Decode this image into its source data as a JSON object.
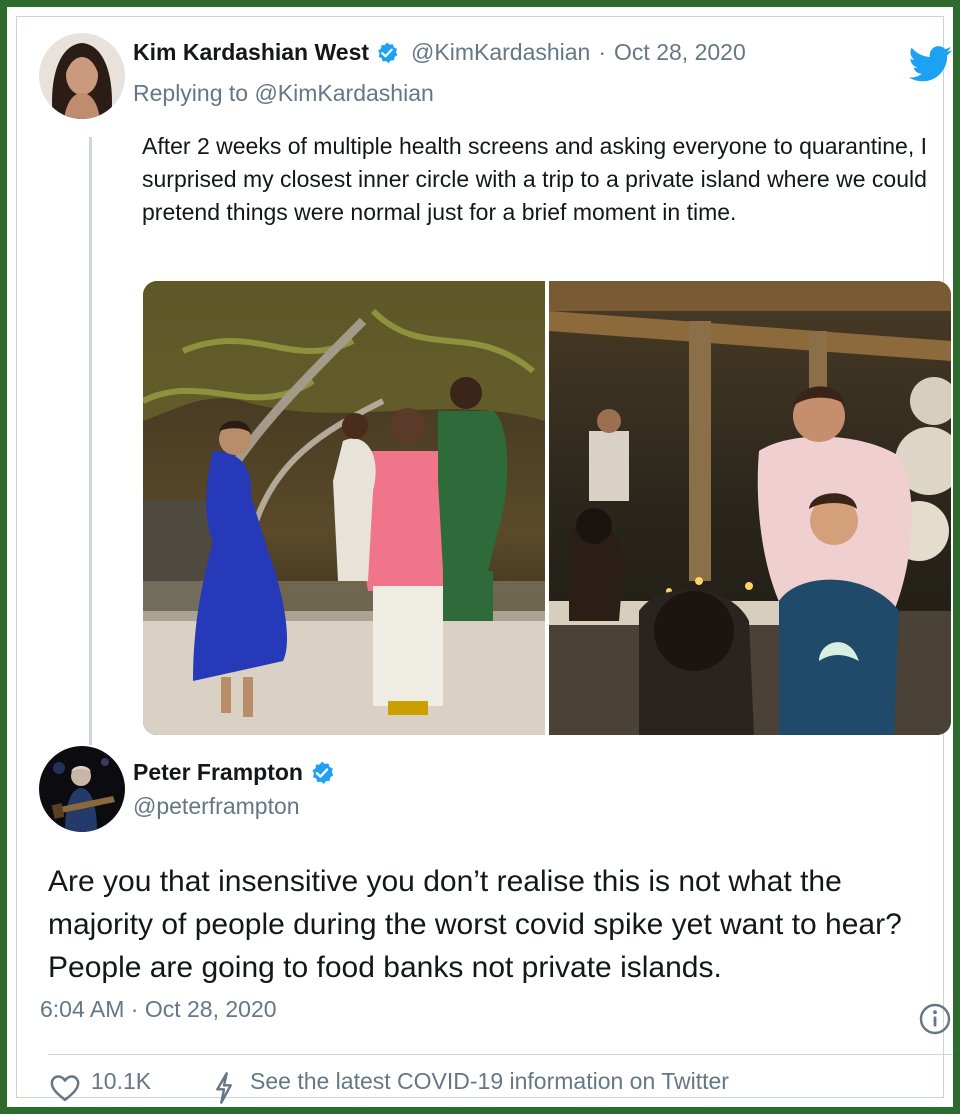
{
  "original_tweet": {
    "author_name": "Kim Kardashian West",
    "author_handle": "@KimKardashian",
    "separator": "·",
    "date": "Oct 28, 2020",
    "replying_to": "Replying to @KimKardashian",
    "text": "After 2 weeks of multiple health screens and asking everyone to quarantine, I surprised my closest inner circle with a trip to a private island where we could pretend things were normal just for a brief moment in time.",
    "verified": true
  },
  "reply_tweet": {
    "author_name": "Peter Frampton",
    "author_handle": "@peterframpton",
    "verified": true,
    "text": "Are you that insensitive you don’t realise this is not what the majority of people during the worst covid spike yet want to hear? People are going to food banks not private islands.",
    "timestamp": "6:04 AM · Oct 28, 2020"
  },
  "actions": {
    "like_count": "10.1K",
    "covid_link": "See the latest COVID-19 information on Twitter"
  },
  "icons": {
    "logo": "twitter-bird-icon",
    "verified": "verified-badge-icon",
    "info": "info-icon",
    "like": "heart-icon",
    "covid": "lightning-bolt-icon"
  },
  "colors": {
    "twitter_blue": "#1da1f2",
    "frame_green": "#2c6b2c",
    "muted_text": "#657786",
    "divider": "#ccd6dd"
  }
}
